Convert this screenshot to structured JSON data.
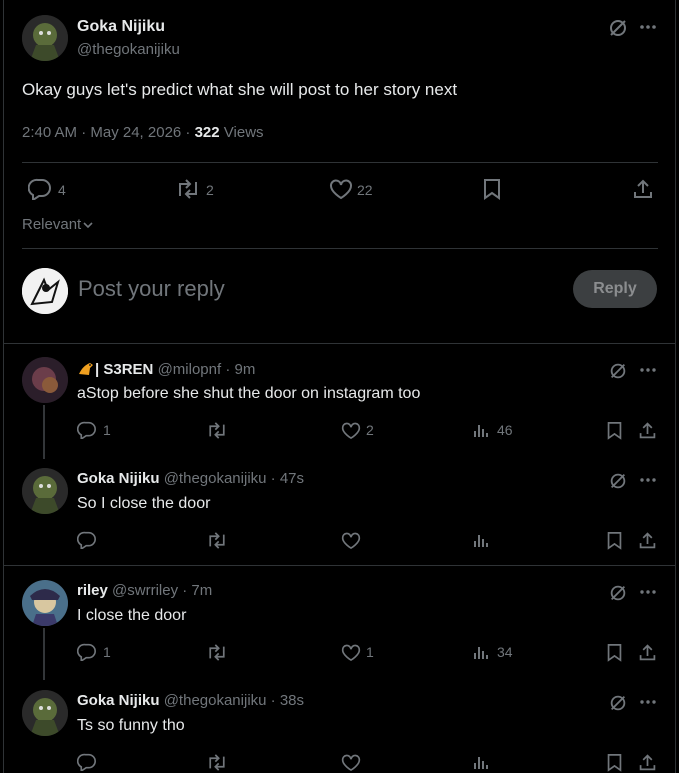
{
  "main_post": {
    "author_name": "Goka Nijiku",
    "author_handle": "@thegokanijiku",
    "text": "Okay guys let's predict what she will post to her story next",
    "time": "2:40 AM · May 24, 2026 · ",
    "views_count": "322",
    "views_label": "Views",
    "replies": "4",
    "reposts": "2",
    "likes": "22"
  },
  "sort_label": "Relevant",
  "composer": {
    "placeholder": "Post your reply",
    "reply_button": "Reply"
  },
  "replies": [
    {
      "badge": "🐎| S3REN",
      "name": "| S3REN",
      "handle": "@milopnf",
      "time": "· 9m",
      "text": "aStop before she shut the door on instagram too",
      "reply_count": "1",
      "repost_count": "",
      "like_count": "2",
      "view_count": "46"
    },
    {
      "name": "Goka Nijiku",
      "handle": "@thegokanijiku",
      "time": "· 47s",
      "text": "So I close the door",
      "reply_count": "",
      "repost_count": "",
      "like_count": "",
      "view_count": ""
    },
    {
      "name": "riley",
      "handle": "@swrriley",
      "time": "· 7m",
      "text": "I close the door",
      "reply_count": "1",
      "repost_count": "",
      "like_count": "1",
      "view_count": "34"
    },
    {
      "name": "Goka Nijiku",
      "handle": "@thegokanijiku",
      "time": "· 38s",
      "text": "Ts so funny tho",
      "reply_count": "",
      "repost_count": "",
      "like_count": "",
      "view_count": ""
    }
  ]
}
